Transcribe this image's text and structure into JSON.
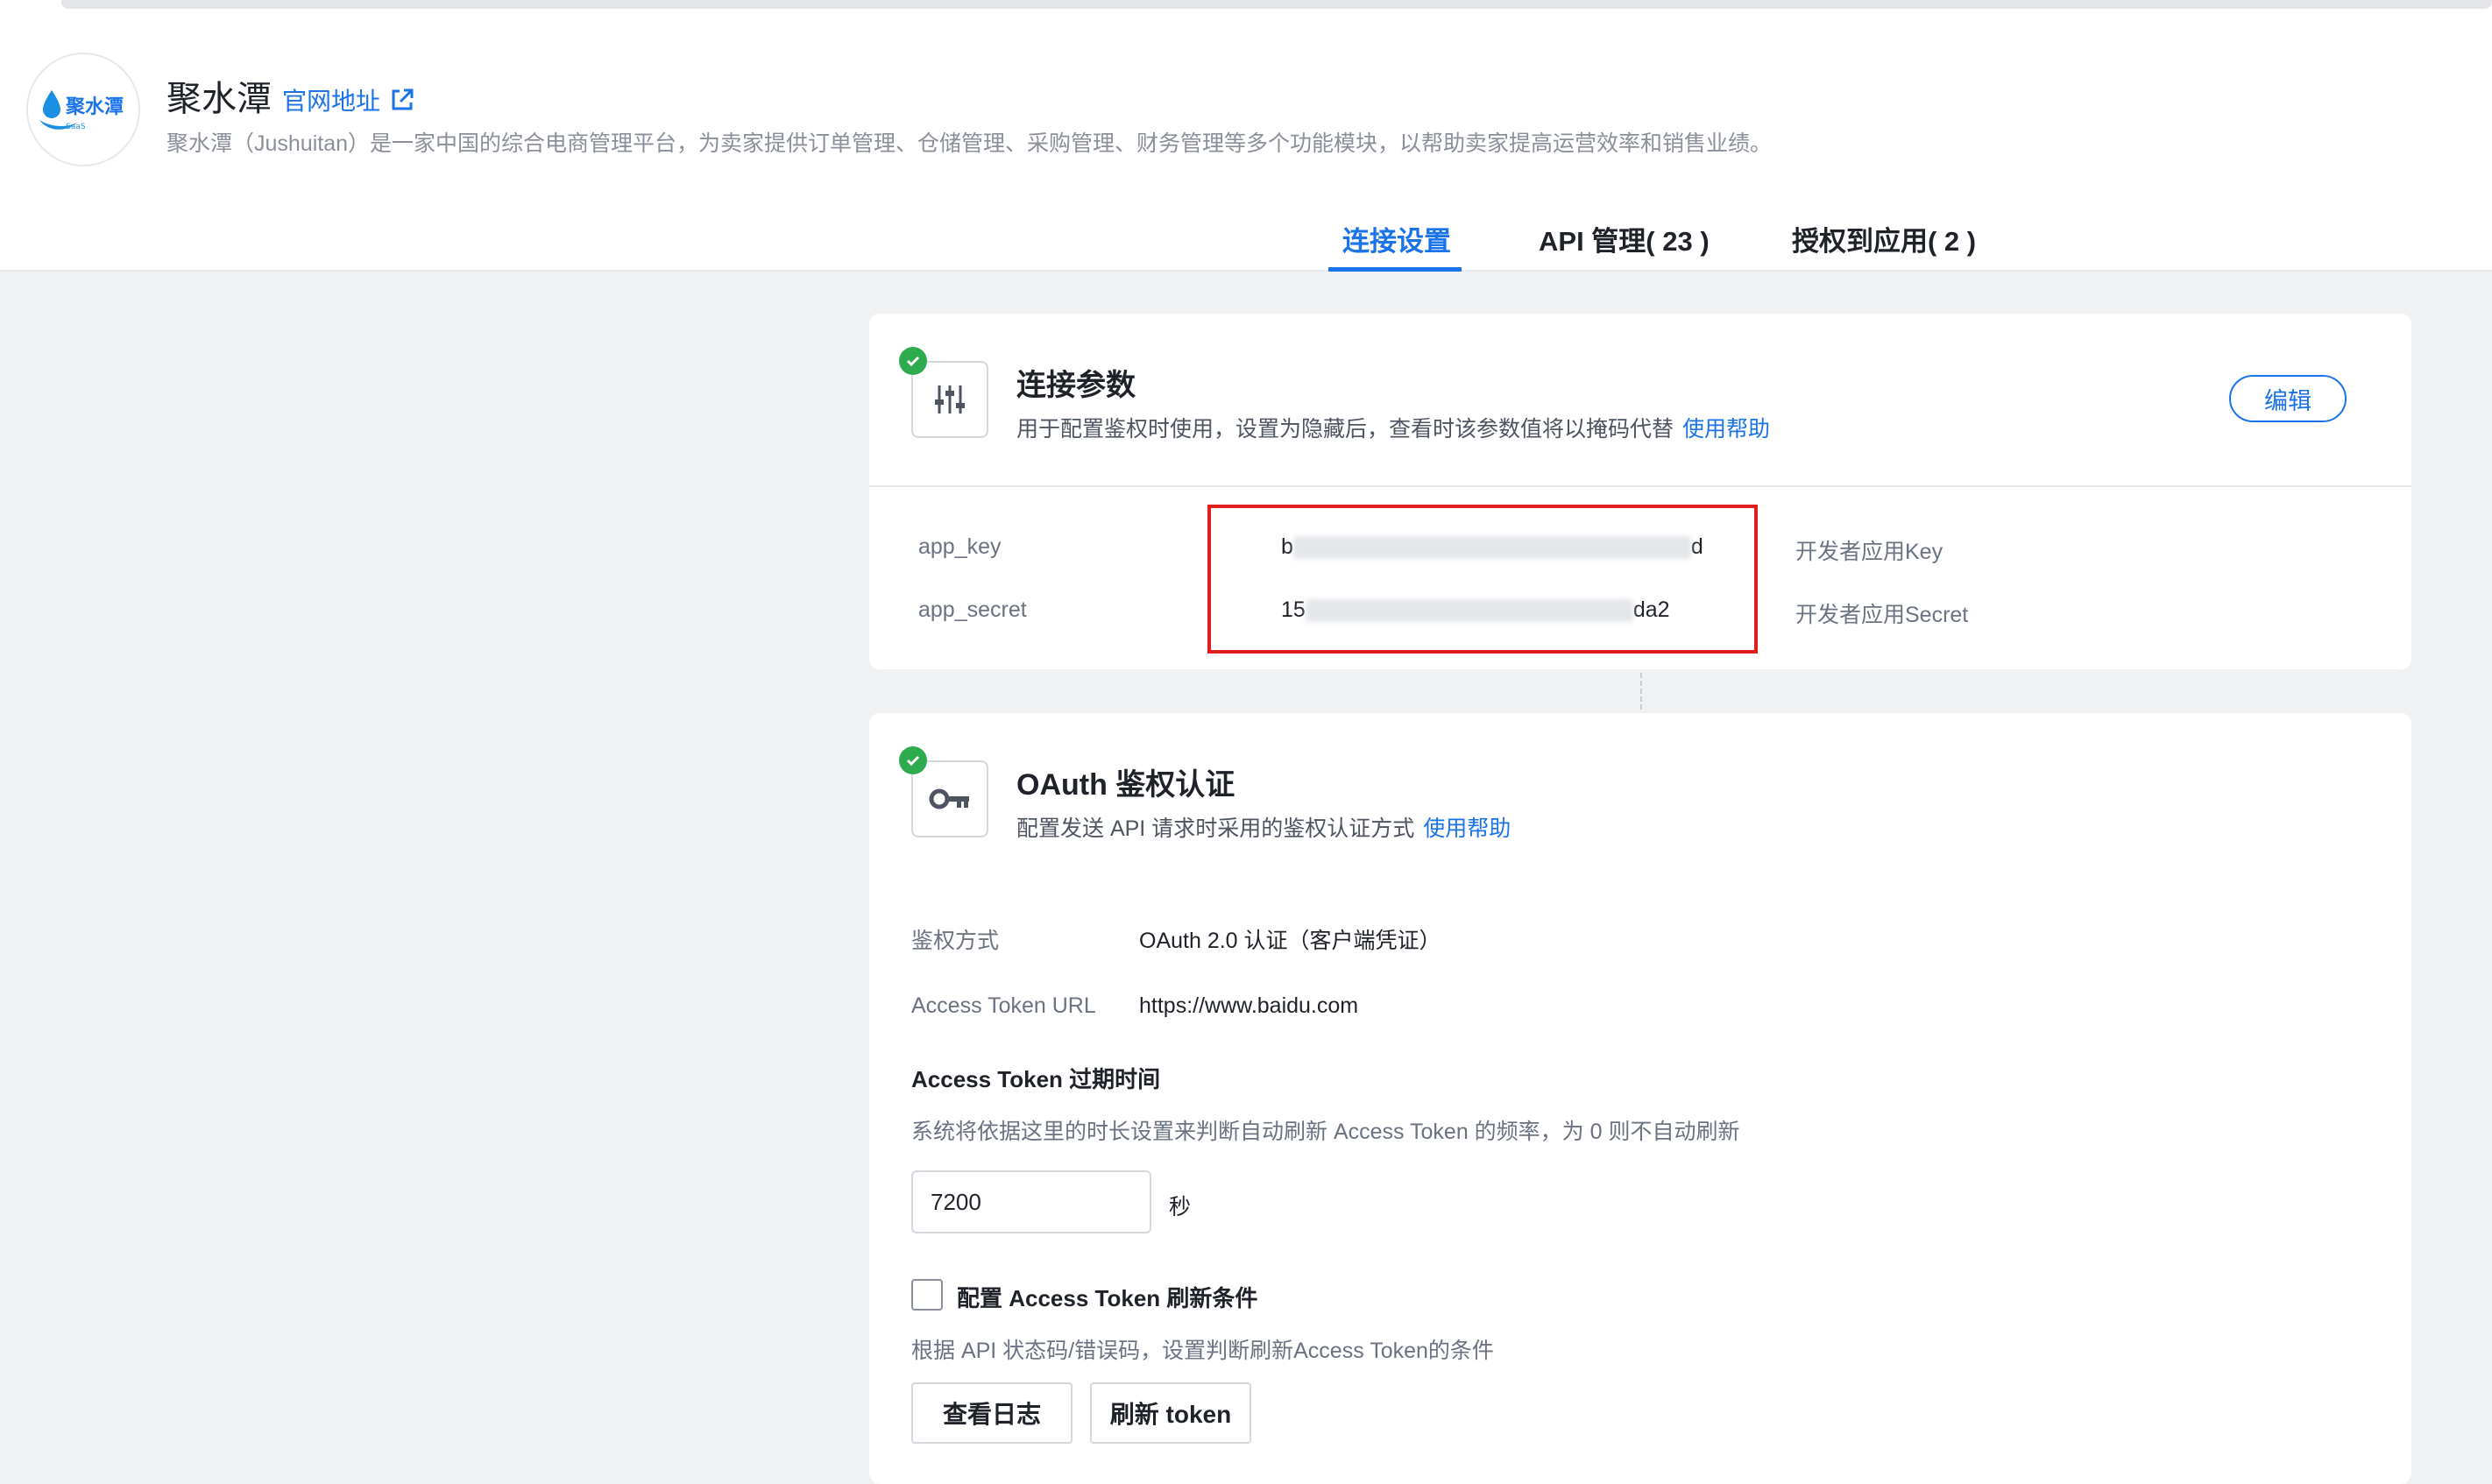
{
  "app": {
    "name": "聚水潭",
    "logo_text": "聚水潭",
    "logo_subtext": "SaaS",
    "site_link_label": "官网地址",
    "description": "聚水潭（Jushuitan）是一家中国的综合电商管理平台，为卖家提供订单管理、仓储管理、采购管理、财务管理等多个功能模块，以帮助卖家提高运营效率和销售业绩。"
  },
  "tabs": [
    {
      "label": "连接设置",
      "active": true
    },
    {
      "label": "API 管理( 23 )",
      "active": false
    },
    {
      "label": "授权到应用( 2 )",
      "active": false
    }
  ],
  "connection_params": {
    "title": "连接参数",
    "subtitle": "用于配置鉴权时使用，设置为隐藏后，查看时该参数值将以掩码代替",
    "help_label": "使用帮助",
    "edit_label": "编辑",
    "params": [
      {
        "label": "app_key",
        "value_prefix": "b",
        "value_suffix": "d",
        "desc": "开发者应用Key"
      },
      {
        "label": "app_secret",
        "value_prefix": "15",
        "value_suffix": "da2",
        "desc": "开发者应用Secret"
      }
    ]
  },
  "oauth": {
    "title": "OAuth 鉴权认证",
    "subtitle": "配置发送 API 请求时采用的鉴权认证方式",
    "help_label": "使用帮助",
    "auth_method_label": "鉴权方式",
    "auth_method_value": "OAuth 2.0 认证（客户端凭证）",
    "token_url_label": "Access Token URL",
    "token_url_value": "https://www.baidu.com",
    "expiry_title": "Access Token 过期时间",
    "expiry_desc": "系统将依据这里的时长设置来判断自动刷新 Access Token 的频率，为 0 则不自动刷新",
    "expiry_value": "7200",
    "expiry_unit": "秒",
    "refresh_condition_label": "配置 Access Token 刷新条件",
    "refresh_condition_checked": false,
    "refresh_condition_desc": "根据 API 状态码/错误码，设置判断刷新Access Token的条件",
    "view_log_label": "查看日志",
    "refresh_token_label": "刷新 token"
  },
  "colors": {
    "accent": "#1a73e8",
    "success": "#2eaa4f",
    "highlight": "#e01e1e"
  }
}
